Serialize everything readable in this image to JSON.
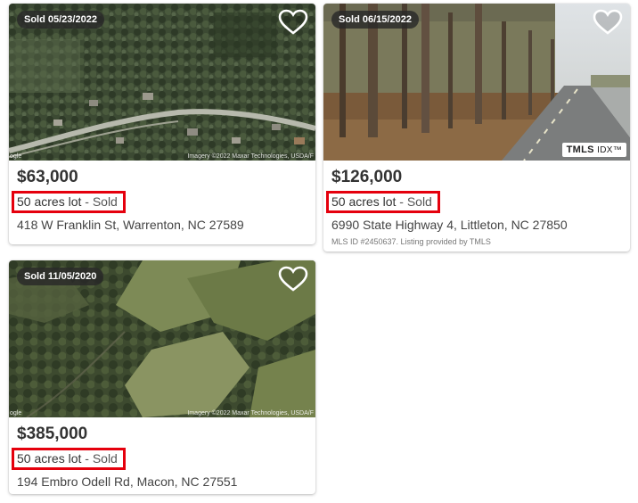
{
  "listings": [
    {
      "sold_badge": "Sold 05/23/2022",
      "price": "$63,000",
      "lot": "50 acres lot",
      "status": " - Sold",
      "address": "418 W Franklin St, Warrenton, NC 27589",
      "imagery_credit": "Imagery ©2022 Maxar Technologies, USDA/F",
      "imagery_left": "ogle"
    },
    {
      "sold_badge": "Sold 06/15/2022",
      "price": "$126,000",
      "lot": "50 acres lot",
      "status": " - Sold",
      "address": "6990 State Highway 4, Littleton, NC 27850",
      "mls": "MLS ID #2450637. Listing provided by TMLS",
      "logo_main": "TMLS",
      "logo_idx": "IDX™"
    },
    {
      "sold_badge": "Sold 11/05/2020",
      "price": "$385,000",
      "lot": "50 acres lot",
      "status": " - Sold",
      "address": "194 Embro Odell Rd, Macon, NC 27551",
      "imagery_credit": "Imagery ©2022 Maxar Technologies, USDA/F",
      "imagery_left": "ogle"
    }
  ],
  "icons": {
    "favorite": "heart-outline-icon"
  },
  "colors": {
    "highlight_box": "#e5000d",
    "badge_bg": "#282828"
  }
}
